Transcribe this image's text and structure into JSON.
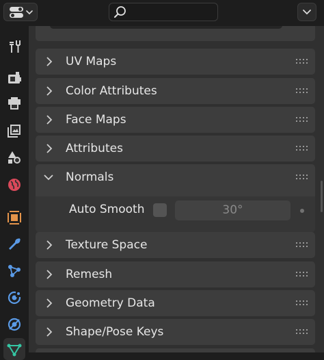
{
  "header": {
    "editor_type_icon": "properties-editor-icon",
    "search_icon": "search-icon",
    "search": {
      "value": "",
      "placeholder": ""
    },
    "menu_icon": "chevron-down-icon"
  },
  "tabs": [
    {
      "name": "tool-icon"
    },
    {
      "name": "render-icon"
    },
    {
      "name": "output-icon"
    },
    {
      "name": "view-layer-icon"
    },
    {
      "name": "scene-icon"
    },
    {
      "name": "world-icon"
    },
    {
      "name": "object-icon"
    },
    {
      "name": "modifier-icon"
    },
    {
      "name": "particles-icon"
    },
    {
      "name": "physics-icon"
    },
    {
      "name": "constraints-icon"
    },
    {
      "name": "data-icon",
      "active": true
    }
  ],
  "panels": [
    {
      "label": "UV Maps",
      "expanded": false
    },
    {
      "label": "Color Attributes",
      "expanded": false
    },
    {
      "label": "Face Maps",
      "expanded": false
    },
    {
      "label": "Attributes",
      "expanded": false
    },
    {
      "label": "Normals",
      "expanded": true
    },
    {
      "label": "Texture Space",
      "expanded": false
    },
    {
      "label": "Remesh",
      "expanded": false
    },
    {
      "label": "Geometry Data",
      "expanded": false
    },
    {
      "label": "Shape/Pose Keys",
      "expanded": false
    }
  ],
  "normals": {
    "auto_smooth_label": "Auto Smooth",
    "auto_smooth_checked": false,
    "angle_value": "30°"
  },
  "colors": {
    "accent_orange": "#e5944a",
    "accent_blue": "#5a9ae6",
    "accent_green": "#35c7a4"
  }
}
